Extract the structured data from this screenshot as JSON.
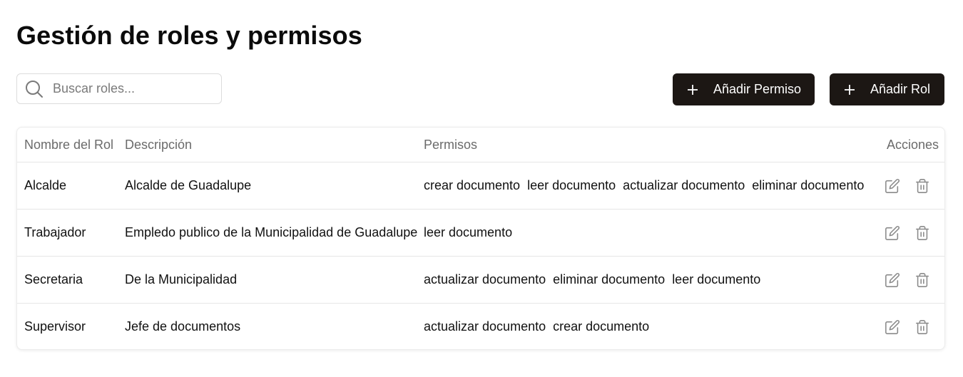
{
  "page": {
    "title": "Gestión de roles y permisos"
  },
  "search": {
    "placeholder": "Buscar roles...",
    "value": "",
    "icon": "search-icon"
  },
  "toolbar": {
    "add_permission_label": "Añadir Permiso",
    "add_role_label": "Añadir Rol",
    "button_color": "#1c1714"
  },
  "table": {
    "headers": {
      "name": "Nombre del Rol",
      "description": "Descripción",
      "permissions": "Permisos",
      "actions": "Acciones"
    },
    "rows": [
      {
        "name": "Alcalde",
        "description": "Alcalde de Guadalupe",
        "permissions": [
          "crear documento",
          "leer documento",
          "actualizar documento",
          "eliminar documento"
        ]
      },
      {
        "name": "Trabajador",
        "description": "Empledo publico de la Municipalidad de Guadalupe",
        "permissions": [
          "leer documento"
        ]
      },
      {
        "name": "Secretaria",
        "description": "De la Municipalidad",
        "permissions": [
          "actualizar documento",
          "eliminar documento",
          "leer documento"
        ]
      },
      {
        "name": "Supervisor",
        "description": "Jefe de documentos",
        "permissions": [
          "actualizar documento",
          "crear documento"
        ]
      }
    ]
  }
}
